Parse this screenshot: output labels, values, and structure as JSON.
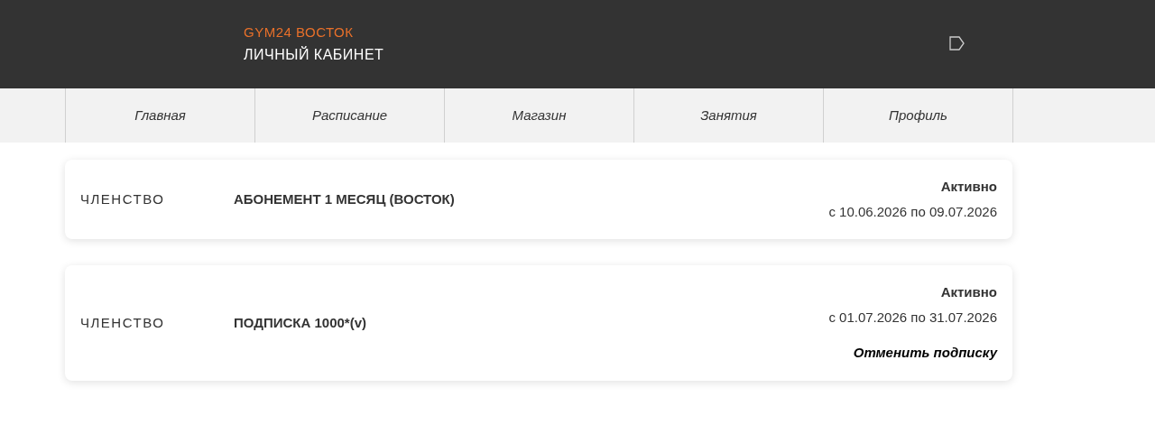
{
  "header": {
    "brand": "GYM24 ВОСТОК",
    "subtitle": "ЛИЧНЫЙ КАБИНЕТ"
  },
  "nav": [
    {
      "label": "Главная"
    },
    {
      "label": "Расписание"
    },
    {
      "label": "Магазин"
    },
    {
      "label": "Занятия"
    },
    {
      "label": "Профиль"
    }
  ],
  "memberships": [
    {
      "type": "ЧЛЕНСТВО",
      "name": "АБОНЕМЕНТ 1 МЕСЯЦ (ВОСТОК)",
      "status": "Активно",
      "period": "с 10.06.2026 по 09.07.2026"
    },
    {
      "type": "ЧЛЕНСТВО",
      "name": "ПОДПИСКА 1000*(v)",
      "status": "Активно",
      "period": "с 01.07.2026 по 31.07.2026",
      "action": "Отменить подписку"
    }
  ]
}
